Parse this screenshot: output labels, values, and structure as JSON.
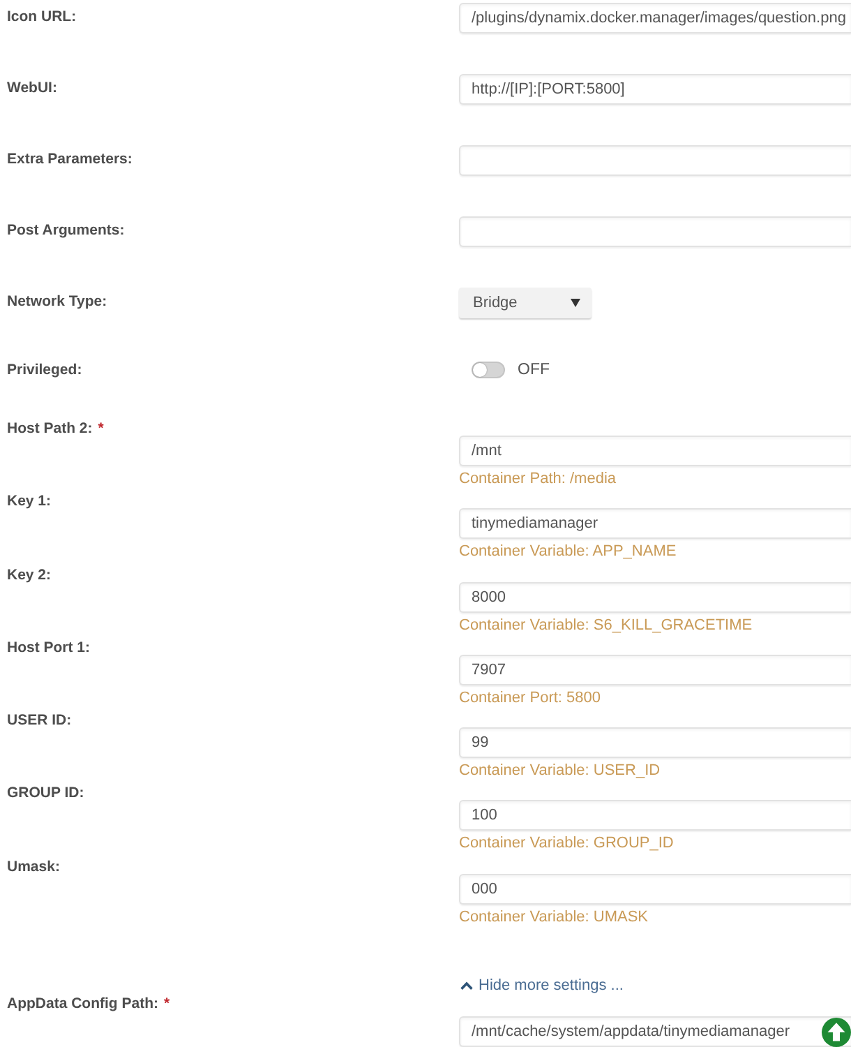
{
  "form": {
    "rows": [
      {
        "kind": "text",
        "label": "Icon URL:",
        "value": "/plugins/dynamix.docker.manager/images/question.png"
      },
      {
        "kind": "text",
        "label": "WebUI:",
        "value": "http://[IP]:[PORT:5800]"
      },
      {
        "kind": "text",
        "label": "Extra Parameters:"
      },
      {
        "kind": "text",
        "label": "Post Arguments:"
      },
      {
        "kind": "select",
        "label": "Network Type:",
        "value": "Bridge"
      },
      {
        "kind": "toggle",
        "label": "Privileged:",
        "on": false,
        "state_label": "OFF"
      },
      {
        "kind": "text",
        "label": "Host Path 2:",
        "required_mark": "*",
        "value": "/mnt",
        "description": "Container Path: /media"
      },
      {
        "kind": "text",
        "label": "Key 1:",
        "value": "tinymediamanager",
        "description": "Container Variable: APP_NAME"
      },
      {
        "kind": "text",
        "label": "Key 2:",
        "value": "8000",
        "description": "Container Variable: S6_KILL_GRACETIME"
      },
      {
        "kind": "text",
        "label": "Host Port 1:",
        "value": "7907",
        "description": "Container Port: 5800"
      },
      {
        "kind": "text",
        "label": "USER ID:",
        "value": "99",
        "description": "Container Variable: USER_ID"
      },
      {
        "kind": "text",
        "label": "GROUP ID:",
        "value": "100",
        "description": "Container Variable: GROUP_ID"
      },
      {
        "kind": "text",
        "label": "Umask:",
        "value": "000",
        "description": "Container Variable: UMASK"
      }
    ]
  },
  "more_settings": {
    "label": "Hide more settings ...",
    "expanded": true
  },
  "config_rows": [
    {
      "kind": "path",
      "label": "AppData Config Path:",
      "required_mark": "*",
      "value": "/mnt/cache/system/appdata/tinymediamanager"
    }
  ]
}
